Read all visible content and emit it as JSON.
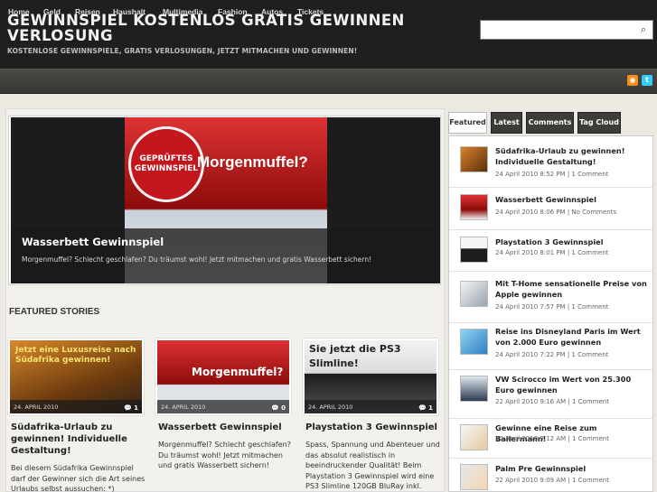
{
  "header": {
    "title": "GEWINNSPIEL KOSTENLOS GRATIS GEWINNEN VERLOSUNG",
    "description": "KOSTENLOSE GEWINNSPIELE, GRATIS VERLOSUNGEN, JETZT MITMACHEN UND GEWINNEN!",
    "search_placeholder": "",
    "search_icon": "search-icon"
  },
  "nav": {
    "items": [
      "Home",
      "Geld",
      "Reisen",
      "Haushalt",
      "Multimedia",
      "Fashion",
      "Autos",
      "Tickets"
    ],
    "rss_icon": "rss-icon",
    "twitter_icon": "twitter-icon"
  },
  "slider": {
    "title": "Wasserbett Gewinnspiel",
    "excerpt": "Morgenmuffel? Schlecht geschlafen? Du träumst wohl! Jetzt mitmachen und gratis Wasserbett sichern!",
    "image_seal": "GEPRÜFTES GEWINNSPIEL",
    "image_headline": "Morgenmuffel?"
  },
  "featured": {
    "heading": "FEATURED STORIES",
    "cards": [
      {
        "date": "24. APRIL 2010",
        "comments": "1",
        "title": "Südafrika-Urlaub zu gewinnen! Individuelle Gestaltung!",
        "excerpt": "Bei diesem Südafrika Gewinnspiel darf der Gewinner sich die Art seines Urlaubs selbst aussuchen: *)",
        "image_text": "Jetzt eine Luxusreise nach Südafrika gewinnen!"
      },
      {
        "date": "24. APRIL 2010",
        "comments": "0",
        "title": "Wasserbett Gewinnspiel",
        "excerpt": "Morgenmuffel? Schlecht geschlafen? Du träumst wohl! Jetzt mitmachen und gratis Wasserbett sichern!",
        "image_text": "Morgenmuffel?"
      },
      {
        "date": "24. APRIL 2010",
        "comments": "1",
        "title": "Playstation 3 Gewinnspiel",
        "excerpt": "Spass, Spannung und Abenteuer und das absolut realistisch in beeindruckender Qualität! Beim Playstation 3 Gewinnspiel wird eine PS3 Slimline 120GB BluRay inkl.",
        "image_text": "Sie jetzt die PS3 Slimline!"
      }
    ]
  },
  "sidebar": {
    "tabs": [
      "Featured",
      "Latest",
      "Comments",
      "Tag Cloud"
    ],
    "active_tab": "Featured",
    "items": [
      {
        "title": "Südafrika-Urlaub zu gewinnen! Individuelle Gestaltung!",
        "meta": "24 April 2010 8:52 PM | 1 Comment"
      },
      {
        "title": "Wasserbett Gewinnspiel",
        "meta": "24 April 2010 8:06 PM | No Comments"
      },
      {
        "title": "Playstation 3 Gewinnspiel",
        "meta": "24 April 2010 8:01 PM | 1 Comment"
      },
      {
        "title": "Mit T-Home sensationelle Preise von Apple gewinnen",
        "meta": "24 April 2010 7:57 PM | 1 Comment"
      },
      {
        "title": "Reise ins Disneyland Paris im Wert von 2.000 Euro gewinnen",
        "meta": "24 April 2010 7:22 PM | 1 Comment"
      },
      {
        "title": "VW Scirocco im Wert von 25.300 Euro gewinnen",
        "meta": "22 April 2010 9:16 AM | 1 Comment"
      },
      {
        "title": "Gewinne eine Reise zum Ballermann!",
        "meta": "22 April 2010 9:12 AM | 1 Comment"
      },
      {
        "title": "Palm Pre Gewinnspiel",
        "meta": "22 April 2010 9:09 AM | 1 Comment"
      }
    ]
  }
}
